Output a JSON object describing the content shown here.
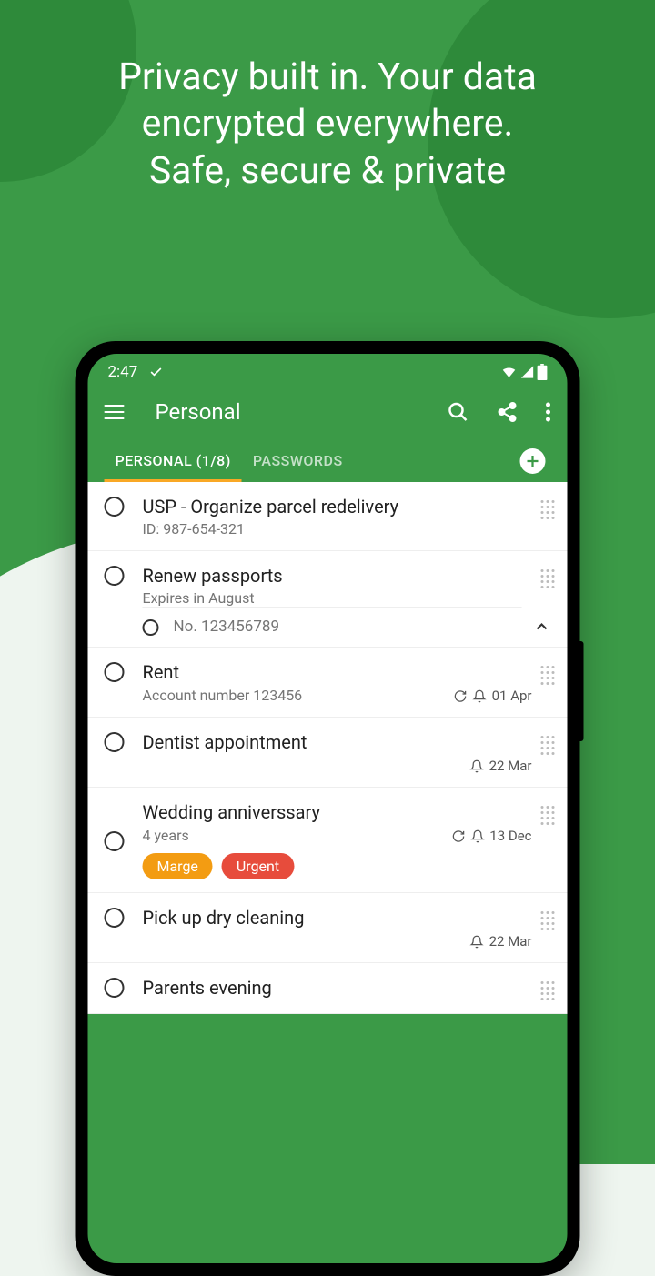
{
  "headline": {
    "line1": "Privacy built in. Your data encrypted everywhere.",
    "line2": "Safe, secure & private"
  },
  "status": {
    "time": "2:47"
  },
  "appbar": {
    "title": "Personal"
  },
  "tabs": {
    "items": [
      {
        "label": "PERSONAL (1/8)",
        "active": true
      },
      {
        "label": "PASSWORDS",
        "active": false
      }
    ]
  },
  "items": [
    {
      "title": "USP - Organize parcel redelivery",
      "subtitle": "ID: 987-654-321"
    },
    {
      "title": "Renew passports",
      "subtitle": "Expires in August",
      "expanded": true,
      "subitems": [
        {
          "text": "No. 123456789"
        }
      ]
    },
    {
      "title": "Rent",
      "subtitle": "Account number 123456",
      "date": "01 Apr",
      "recur": true,
      "alarm": true
    },
    {
      "title": "Dentist appointment",
      "date": "22 Mar",
      "alarm": true
    },
    {
      "title": "Wedding anniverssary",
      "subtitle": "4 years",
      "date": "13 Dec",
      "recur": true,
      "alarm": true,
      "tags": [
        {
          "label": "Marge",
          "color": "orange"
        },
        {
          "label": "Urgent",
          "color": "red"
        }
      ]
    },
    {
      "title": "Pick up dry cleaning",
      "date": "22 Mar",
      "alarm": true
    },
    {
      "title": "Parents evening"
    }
  ]
}
